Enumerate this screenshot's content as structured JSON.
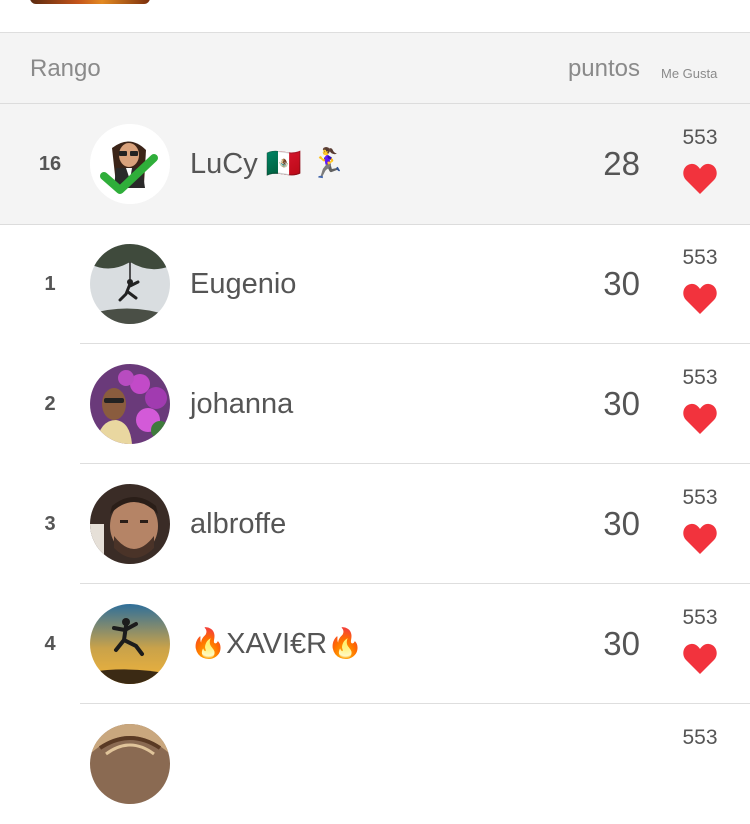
{
  "header": {
    "rank_label": "Rango",
    "points_label": "puntos",
    "likes_label": "Me Gusta"
  },
  "rows": [
    {
      "rank": "16",
      "name": "LuCy 🇲🇽 🏃‍♀️",
      "points": "28",
      "likes": "553",
      "avatar": "bitmoji-checkmark-icon"
    },
    {
      "rank": "1",
      "name": "Eugenio",
      "points": "30",
      "likes": "553",
      "avatar": "climber-photo"
    },
    {
      "rank": "2",
      "name": "johanna",
      "points": "30",
      "likes": "553",
      "avatar": "woman-flowers-photo"
    },
    {
      "rank": "3",
      "name": "albroffe",
      "points": "30",
      "likes": "553",
      "avatar": "man-portrait-photo"
    },
    {
      "rank": "4",
      "name": "🔥XAVI€R🔥",
      "points": "30",
      "likes": "553",
      "avatar": "jumper-sunset-photo"
    },
    {
      "rank": "",
      "name": "",
      "points": "",
      "likes": "553",
      "avatar": "headdress-photo"
    }
  ],
  "colors": {
    "heart": "#f2333d",
    "highlight_row": "#f4f4f4",
    "check": "#2fae3a"
  }
}
